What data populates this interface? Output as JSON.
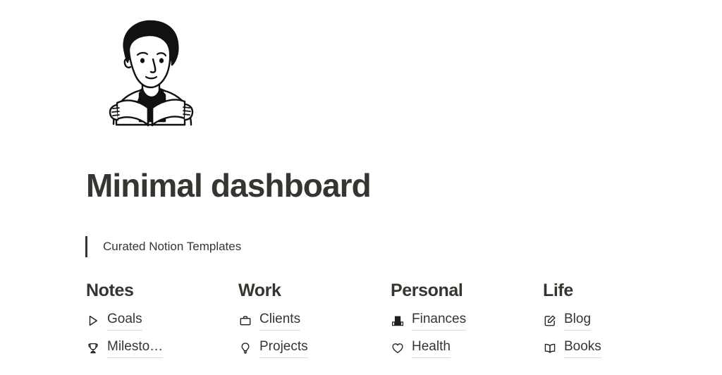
{
  "page": {
    "title": "Minimal dashboard",
    "cover_illustration": "person-reading-book-illustration",
    "background_color": "#ffffff",
    "text_color": "#37352f",
    "underline_color": "#dcdad6"
  },
  "quote": {
    "text": "Curated Notion Templates",
    "bar_color": "#37352f"
  },
  "columns": [
    {
      "title": "Notes",
      "links": [
        {
          "label": "Goals",
          "icon": "cursor-arrow-icon"
        },
        {
          "label": "Milesto…",
          "icon": "trophy-icon"
        }
      ]
    },
    {
      "title": "Work",
      "links": [
        {
          "label": "Clients",
          "icon": "briefcase-icon"
        },
        {
          "label": "Projects",
          "icon": "lightbulb-icon"
        }
      ]
    },
    {
      "title": "Personal",
      "links": [
        {
          "label": "Finances",
          "icon": "bar-chart-icon"
        },
        {
          "label": "Health",
          "icon": "heart-icon"
        }
      ]
    },
    {
      "title": "Life",
      "links": [
        {
          "label": "Blog",
          "icon": "edit-square-icon"
        },
        {
          "label": "Books",
          "icon": "open-book-icon"
        }
      ]
    }
  ]
}
